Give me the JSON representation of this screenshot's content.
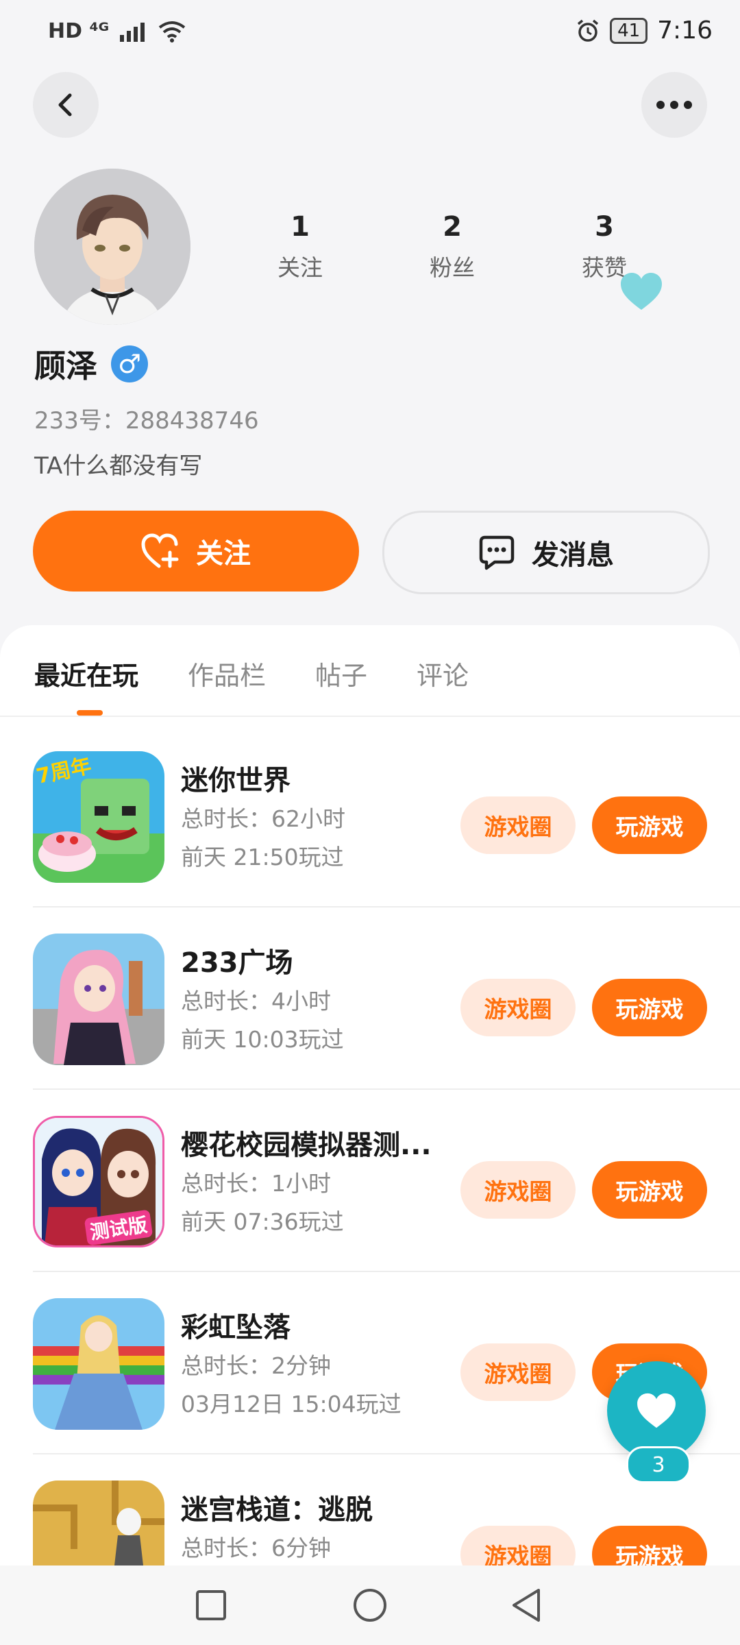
{
  "status_bar": {
    "left_indicators": "HD ⁴ᴳ",
    "battery": "41",
    "time": "7:16"
  },
  "profile": {
    "stats": [
      {
        "value": "1",
        "label": "关注"
      },
      {
        "value": "2",
        "label": "粉丝"
      },
      {
        "value": "3",
        "label": "获赞"
      }
    ],
    "name": "顾泽",
    "gender_symbol": "♂",
    "id_line": "233号：288438746",
    "bio": "TA什么都没有写",
    "follow_label": "关注",
    "message_label": "发消息"
  },
  "tabs": [
    "最近在玩",
    "作品栏",
    "帖子",
    "评论"
  ],
  "games": [
    {
      "title": "迷你世界",
      "duration": "总时长：62小时",
      "last_played": "前天 21:50玩过",
      "circle_label": "游戏圈",
      "play_label": "玩游戏",
      "icon_text": "7周年"
    },
    {
      "title": "233广场",
      "duration": "总时长：4小时",
      "last_played": "前天 10:03玩过",
      "circle_label": "游戏圈",
      "play_label": "玩游戏",
      "icon_text": ""
    },
    {
      "title": "樱花校园模拟器测...",
      "duration": "总时长：1小时",
      "last_played": "前天 07:36玩过",
      "circle_label": "游戏圈",
      "play_label": "玩游戏",
      "icon_text": "测试版"
    },
    {
      "title": "彩虹坠落",
      "duration": "总时长：2分钟",
      "last_played": "03月12日 15:04玩过",
      "circle_label": "游戏圈",
      "play_label": "玩游戏",
      "icon_text": ""
    },
    {
      "title": "迷宫栈道：逃脱",
      "duration": "总时长：6分钟",
      "last_played": "",
      "circle_label": "游戏圈",
      "play_label": "玩游戏",
      "icon_text": ""
    }
  ],
  "floating_like": {
    "count": "3"
  },
  "colors": {
    "accent": "#ff7210",
    "accent_light": "#ffe8dc",
    "teal": "#1cb5c4",
    "male_blue": "#3d97e8"
  }
}
